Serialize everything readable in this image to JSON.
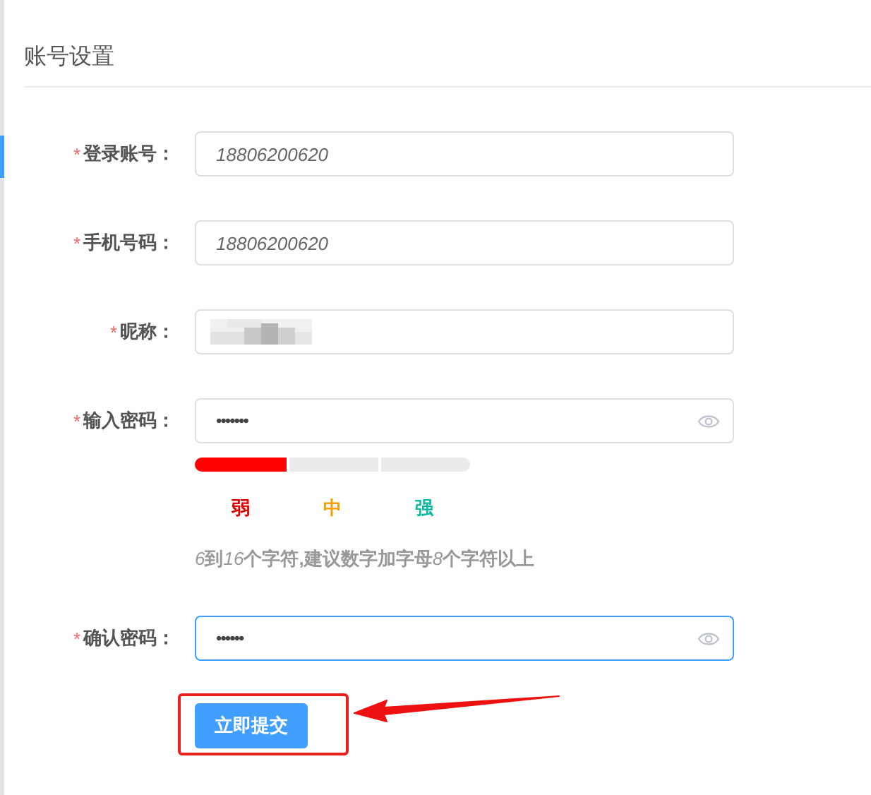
{
  "title": "账号设置",
  "fields": [
    {
      "label": "登录账号：",
      "required_mark": "*",
      "kind": "text",
      "value": "18806200620",
      "focused": false
    },
    {
      "label": "手机号码：",
      "required_mark": "*",
      "kind": "text",
      "value": "18806200620",
      "focused": false
    },
    {
      "label": "昵称：",
      "required_mark": "*",
      "kind": "blurred",
      "focused": false
    },
    {
      "label": "输入密码：",
      "required_mark": "*",
      "kind": "password",
      "value": "•••••••",
      "focused": false
    },
    {
      "label": "确认密码：",
      "required_mark": "*",
      "kind": "password",
      "value": "••••••",
      "focused": true
    }
  ],
  "strength": {
    "level": 0.333,
    "labels": [
      {
        "text": "弱",
        "color": "#dd0000"
      },
      {
        "text": "中",
        "color": "#f5a000"
      },
      {
        "text": "强",
        "color": "#10b9a2"
      }
    ]
  },
  "hint": [
    {
      "text": "6",
      "italic": true
    },
    {
      "text": "到",
      "italic": false
    },
    {
      "text": "16",
      "italic": true
    },
    {
      "text": "个字符,建议数字加字母",
      "italic": false
    },
    {
      "text": "8",
      "italic": true
    },
    {
      "text": "个字符以上",
      "italic": false
    }
  ],
  "submit": "立即提交",
  "annotation": {
    "highlight_box": true,
    "arrow": true
  }
}
